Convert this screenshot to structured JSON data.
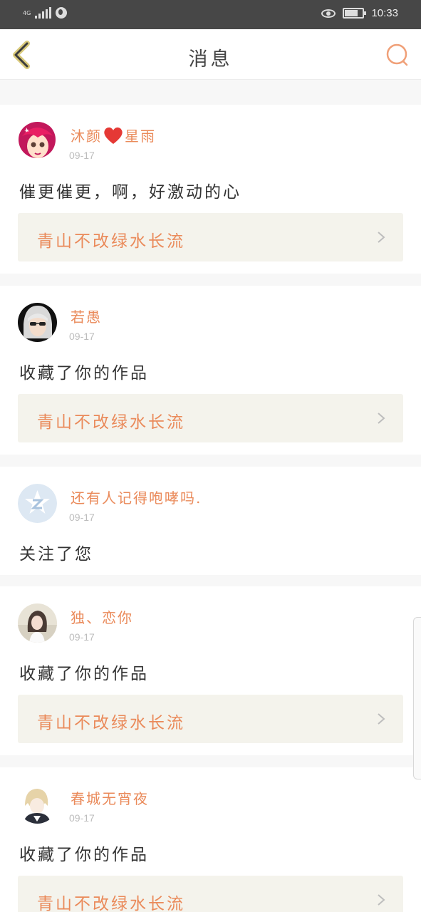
{
  "status_bar": {
    "network": "4G",
    "time": "10:33"
  },
  "header": {
    "title": "消息"
  },
  "colors": {
    "accent": "#ea8a5a",
    "card_bg": "#f4f3ec"
  },
  "messages": [
    {
      "user": "沐颜",
      "user_suffix": "星雨",
      "has_heart": true,
      "date": "09-17",
      "text": "催更催更，啊，好激动的心",
      "work_title": "青山不改绿水长流",
      "avatar": "pink-cartoon-avatar"
    },
    {
      "user": "若愚",
      "date": "09-17",
      "text": "收藏了你的作品",
      "work_title": "青山不改绿水长流",
      "avatar": "silver-hair-avatar"
    },
    {
      "user": "还有人记得咆哮吗.",
      "date": "09-17",
      "text": "关注了您",
      "avatar": "default-z-avatar"
    },
    {
      "user": "独、恋你",
      "date": "09-17",
      "text": "收藏了你的作品",
      "work_title": "青山不改绿水长流",
      "avatar": "girl-photo-avatar"
    },
    {
      "user": "春城无宵夜",
      "date": "09-17",
      "text": "收藏了你的作品",
      "work_title": "青山不改绿水长流",
      "avatar": "anime-boy-avatar"
    }
  ]
}
